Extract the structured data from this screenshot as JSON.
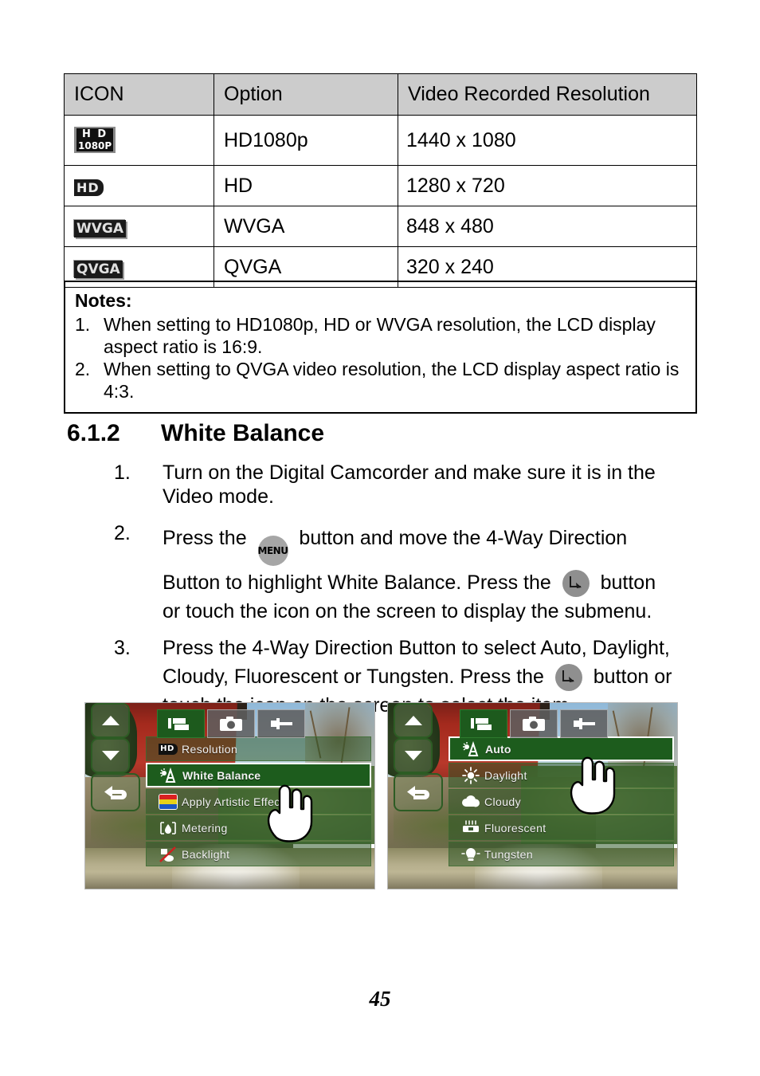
{
  "resolution_table": {
    "headers": [
      "ICON",
      "Option",
      "Video Recorded Resolution"
    ],
    "rows": [
      {
        "icon_name": "hd1080p-icon",
        "icon_top": "H D",
        "icon_bottom": "1080P",
        "option": "HD1080p",
        "resolution": "1440 x 1080"
      },
      {
        "icon_name": "hd-icon",
        "icon_text": "HD",
        "option": "HD",
        "resolution": "1280 x 720"
      },
      {
        "icon_name": "wvga-icon",
        "icon_text": "WVGA",
        "option": "WVGA",
        "resolution": "848 x 480"
      },
      {
        "icon_name": "qvga-icon",
        "icon_text": "QVGA",
        "option": "QVGA",
        "resolution": "320 x 240"
      }
    ]
  },
  "notes": {
    "title": "Notes:",
    "items": [
      {
        "num": "1.",
        "line1": "When setting to HD1080p, HD or WVGA resolution, the LCD display",
        "line2": "aspect ratio is 16:9."
      },
      {
        "num": "2.",
        "line1": "When setting to QVGA video resolution, the LCD display aspect ratio",
        "line2": "is 4:3."
      }
    ]
  },
  "section": {
    "number": "6.1.2",
    "title": "White Balance"
  },
  "steps": [
    {
      "num": "1.",
      "line1": "Turn on the Digital Camcorder and make sure it is in the",
      "line2": "Video mode."
    },
    {
      "num": "2.",
      "pre_menu": "Press the",
      "menu_button_label": "MENU",
      "post_menu": "button and move the 4-Way Direction",
      "line2_pre": "Button to highlight White Balance. Press the",
      "line2_post": "button",
      "line3": "or touch the icon on the screen to display the submenu."
    },
    {
      "num": "3.",
      "line1": "Press the 4-Way Direction Button to select Auto, Daylight,",
      "line2_pre": "Cloudy, Fluorescent or Tungsten. Press the",
      "line2_post": "button or",
      "line3": "touch the icon on the screen to select the item."
    }
  ],
  "lcd_left": {
    "tabs": [
      {
        "name": "video-tab",
        "active": true
      },
      {
        "name": "camera-tab",
        "active": false
      },
      {
        "name": "settings-tab",
        "active": false
      }
    ],
    "side_buttons": [
      "up-arrow",
      "down-arrow",
      "back-arrow"
    ],
    "menu_items": [
      {
        "label": "Resolution",
        "icon": "hd-icon",
        "selected": false
      },
      {
        "label": "White Balance",
        "icon": "white-balance-icon",
        "selected": true
      },
      {
        "label": "Apply Artistic Effect",
        "icon": "artistic-effect-icon",
        "selected": false
      },
      {
        "label": "Metering",
        "icon": "metering-icon",
        "selected": false
      },
      {
        "label": "Backlight",
        "icon": "backlight-icon",
        "selected": false
      }
    ]
  },
  "lcd_right": {
    "tabs": [
      {
        "name": "video-tab",
        "active": true
      },
      {
        "name": "camera-tab",
        "active": false
      },
      {
        "name": "settings-tab",
        "active": false
      }
    ],
    "side_buttons": [
      "up-arrow",
      "down-arrow",
      "back-arrow"
    ],
    "menu_items": [
      {
        "label": "Auto",
        "icon": "auto-wb-icon",
        "selected": true
      },
      {
        "label": "Daylight",
        "icon": "sun-icon",
        "selected": false
      },
      {
        "label": "Cloudy",
        "icon": "cloud-icon",
        "selected": false
      },
      {
        "label": "Fluorescent",
        "icon": "fluorescent-tube-icon",
        "selected": false
      },
      {
        "label": "Tungsten",
        "icon": "lightbulb-icon",
        "selected": false
      }
    ]
  },
  "page_number": "45",
  "colors": {
    "table_header_bg": "#cccccc",
    "menu_selected_green": "#1d5c1d",
    "menu_row_green": "rgba(40,85,35,.52)",
    "button_gray": "#a6a6a6"
  }
}
